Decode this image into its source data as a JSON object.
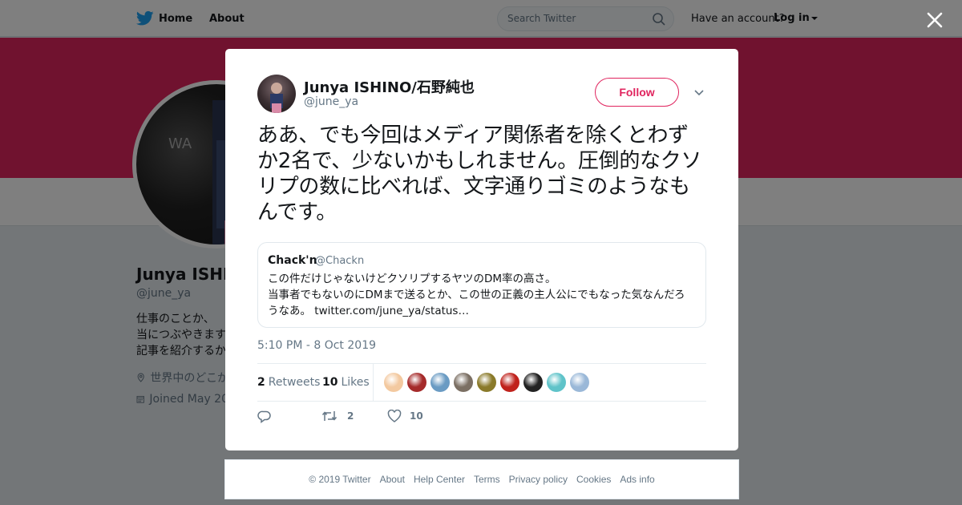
{
  "topbar": {
    "home_label": "Home",
    "about_label": "About",
    "search_placeholder": "Search Twitter",
    "account_question": "Have an account?",
    "login_label": "Log in"
  },
  "profile": {
    "name": "Junya ISHI",
    "handle": "@june_ya",
    "bio_lines": [
      "仕事のことか、",
      "当につぶやきます",
      "記事を紹介するか"
    ],
    "location": "世界中のどこか",
    "joined": "Joined May 20"
  },
  "tweet": {
    "author_name": "Junya ISHINO/石野純也",
    "author_handle": "@june_ya",
    "follow_label": "Follow",
    "text": "ああ、でも今回はメディア関係者を除くとわずか2名で、少ないかもしれません。圧倒的なクソリプの数に比べれば、文字通りゴミのようなもんです。",
    "quote": {
      "name": "Chack'n",
      "handle": "@Chackn",
      "line1": "この件だけじゃないけどクソリプするヤツのDM率の高さ。",
      "line2": "当事者でもないのにDMまで送るとか、この世の正義の主人公にでもなった気なんだろうなあ。",
      "link": "twitter.com/june_ya/status…"
    },
    "timestamp": "5:10 PM - 8 Oct 2019",
    "retweets_count": "2",
    "retweets_label": "Retweets",
    "likes_count": "10",
    "likes_label": "Likes",
    "action_retweet_count": "2",
    "action_like_count": "10"
  },
  "likers": [
    {
      "color": "#f3c9a0"
    },
    {
      "color": "#a52a2a"
    },
    {
      "color": "#6a9bc3"
    },
    {
      "color": "#7b6f63"
    },
    {
      "color": "#8a7a2a"
    },
    {
      "color": "#c0221c"
    },
    {
      "color": "#222222"
    },
    {
      "color": "#5fc3c9"
    },
    {
      "color": "#9ab8d8"
    }
  ],
  "footer": {
    "copyright": "© 2019 Twitter",
    "about": "About",
    "help": "Help Center",
    "terms": "Terms",
    "privacy": "Privacy policy",
    "cookies": "Cookies",
    "ads": "Ads info"
  },
  "colors": {
    "brand": "#1da1f2",
    "banner": "#e0245e",
    "follow_accent": "#e0245e",
    "muted_text": "#657786"
  }
}
